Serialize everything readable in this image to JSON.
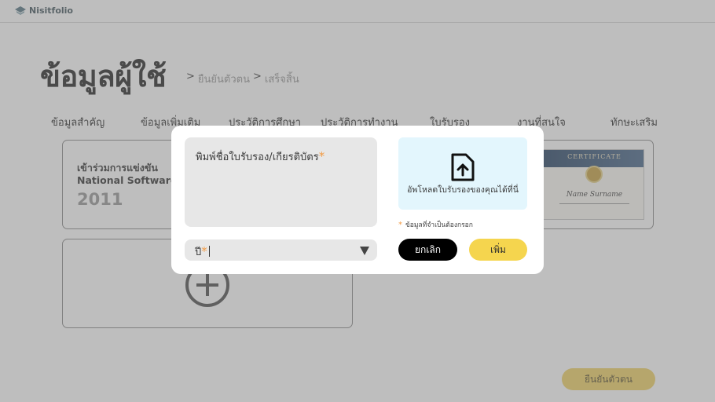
{
  "app": {
    "name": "Nisitfolio"
  },
  "header": {
    "title": "ข้อมูลผู้ใช้",
    "breadcrumb": [
      {
        "sep": ">",
        "label": "ยืนยันตัวตน"
      },
      {
        "sep": ">",
        "label": "เสร็จสิ้น"
      }
    ]
  },
  "tabs": [
    "ข้อมูลสำคัญ",
    "ข้อมูลเพิ่มเติม",
    "ประวัติการศึกษา",
    "ประวัติการทำงาน",
    "ใบรับรอง",
    "งานที่สนใจ",
    "ทักษะเสริม"
  ],
  "certificate_card": {
    "title_line1": "เข้าร่วมการแข่งขัน",
    "title_line2": "National Software Contest",
    "year": "2011",
    "thumbnail": {
      "heading": "CERTIFICATE",
      "name": "Name Surname"
    }
  },
  "confirm_label": "ยืนยันตัวตน",
  "modal": {
    "cert_name_placeholder": "พิมพ์ชื่อใบรับรอง/เกียรติบัตร",
    "year_label": "ปี",
    "required_mark": "*",
    "upload_label": "อัพโหลดใบรับรองของคุณได้ที่นี่",
    "required_note": "ข้อมูลที่จำเป็นต้องกรอก",
    "cancel_label": "ยกเลิก",
    "add_label": "เพิ่ม"
  },
  "colors": {
    "accent_yellow": "#f5d54e",
    "upload_bg": "#e3f6fd",
    "required": "#f29b45",
    "cancel_bg": "#000000"
  },
  "icons": [
    "logo-icon",
    "upload-file-icon",
    "dropdown-arrow-icon",
    "add-circle-icon"
  ]
}
